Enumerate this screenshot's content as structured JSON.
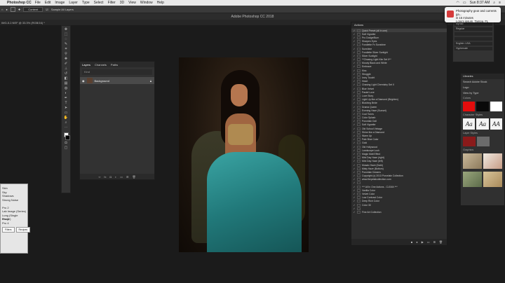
{
  "menubar": {
    "app": "Photoshop CC",
    "items": [
      "File",
      "Edit",
      "Image",
      "Layer",
      "Type",
      "Select",
      "Filter",
      "3D",
      "View",
      "Window",
      "Help"
    ],
    "clock": "Sun 8:37 AM"
  },
  "options": {
    "mode": "Content",
    "sample": "Sample All Layers"
  },
  "window": {
    "title": "Adobe Photoshop CC 2018",
    "doc_tab": "IMG-5.2.NEF @ 33.3% (RGB/16) *"
  },
  "layers": {
    "tabs": [
      "Layers",
      "Channels",
      "Paths"
    ],
    "filter": "Kind",
    "layer_name": "Background"
  },
  "actions": {
    "title": "Actions",
    "items": [
      "Quick Preset (all in one)",
      "Soft Vignette",
      "Pro Dodge/Burn",
      "Sharpen Eyes",
      "Fondlette Fx Sunshine",
      "Sunshine",
      "Fondlette Silver Sunlight",
      "Silver Sunlight",
      "**Chasing Light Kite Set II**",
      "Moody Black and White",
      "Embrace",
      "Kiss",
      "Struggle",
      "Ivory Toucht",
      "Heart",
      "Chasing Light Chemistry Set II",
      "Blue Velvet",
      "Pastel Love",
      "Love Story",
      "Light Up like a Diamond (Brighten)",
      "Blushing Bride",
      "Drama Queen",
      "Evening Haze (Sunset)",
      "Cool Tones",
      "Color Splash",
      "Porcelain Doll",
      "Soft Vignette",
      "Old School Vintage",
      "Shine like a Diamond",
      "Warm Up",
      "Pale Blue Color",
      "Gold",
      "Old Hollywood",
      "Landscape Lush",
      "Magic Matt Effect",
      "Mini Day Haze (right)",
      "Mini Day Haze (left)",
      "Mosaic Haze (Dark)",
      "Misty Haze (Bottom)",
      "Porcelain Dreams",
      "Copyright (c) 2013 Porcelain Collection",
      "www.thepetalcollection.com",
      "",
      "*** All In One Actions - CLEAN ***",
      "Vanilla Color",
      "Velvet Color",
      "Low Contrast Color",
      "Deep Rich Color",
      "Color 30",
      "",
      "Fine Art Collection"
    ]
  },
  "notification": {
    "line1": "Photography gear and currents ga...",
    "line2": "in 15 minutes",
    "line3": "Lorem ipsum, Tampa, FL"
  },
  "char_panel": {
    "fields": [
      "Myriad",
      "Regular",
      "",
      "",
      "English: USA",
      "Hyphenate"
    ]
  },
  "libraries": {
    "title": "Libraries",
    "search": "Search Adobe Stock",
    "sub": "Logo",
    "view": "View by Type",
    "sections": [
      "Colors",
      "Character Styles",
      "Layer Styles",
      "Graphics"
    ],
    "aa": [
      "Aa",
      "Aa",
      "AA"
    ],
    "colors": {
      "red": "#e30d0d",
      "black": "#0a0a0a",
      "white": "#ffffff"
    }
  },
  "left_panel": {
    "items": [
      "Skin",
      "Sky",
      "Shadows",
      "Strong Noise",
      "",
      "Pro 2",
      "Lab Image (Series)",
      "Lung (Single Image)",
      "Pro 4",
      "Pro 4"
    ],
    "buttons": [
      "Filters",
      "Recipes"
    ]
  }
}
